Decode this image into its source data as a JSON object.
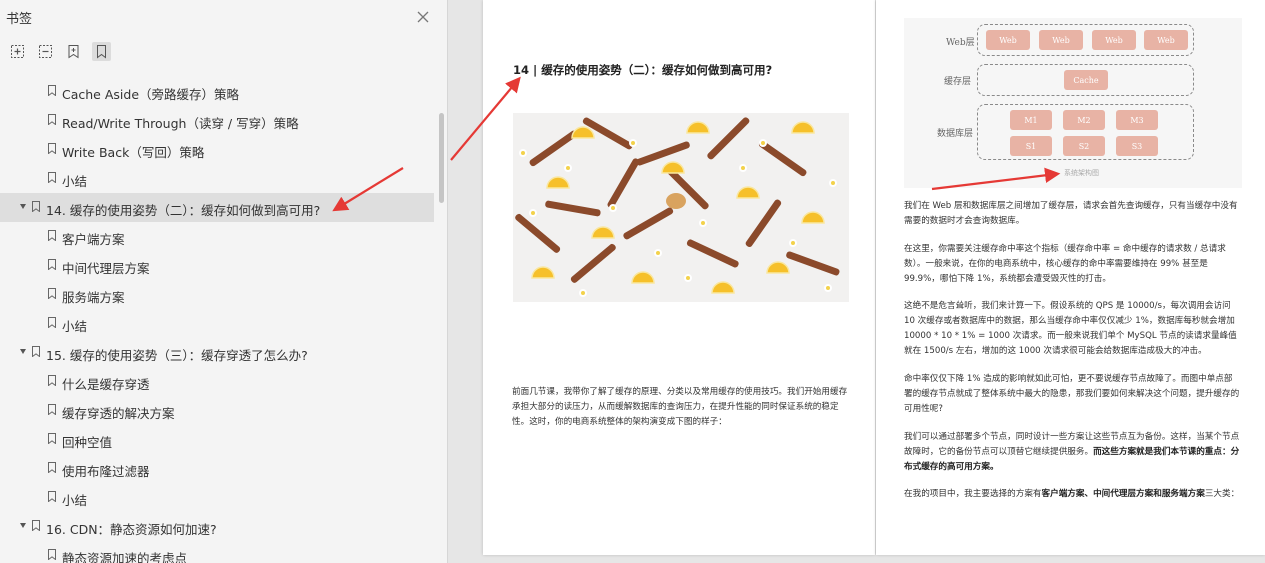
{
  "sidebar": {
    "title": "书签",
    "close_icon": "close-icon",
    "tools": [
      {
        "name": "expand-all-icon"
      },
      {
        "name": "collapse-all-icon"
      },
      {
        "name": "add-bookmark-icon"
      },
      {
        "name": "bookmark-view-icon"
      }
    ],
    "items": [
      {
        "label": "Cache Aside（旁路缓存）策略",
        "level": 2
      },
      {
        "label": "Read/Write Through（读穿 / 写穿）策略",
        "level": 2
      },
      {
        "label": "Write Back（写回）策略",
        "level": 2
      },
      {
        "label": "小结",
        "level": 2
      },
      {
        "label": "14. 缓存的使用姿势（二）：缓存如何做到高可用?",
        "level": 1,
        "selected": true
      },
      {
        "label": "客户端方案",
        "level": 2
      },
      {
        "label": "中间代理层方案",
        "level": 2
      },
      {
        "label": "服务端方案",
        "level": 2
      },
      {
        "label": "小结",
        "level": 2
      },
      {
        "label": "15. 缓存的使用姿势（三）：缓存穿透了怎么办?",
        "level": 1
      },
      {
        "label": "什么是缓存穿透",
        "level": 2
      },
      {
        "label": "缓存穿透的解决方案",
        "level": 2
      },
      {
        "label": "回种空值",
        "level": 2
      },
      {
        "label": "使用布隆过滤器",
        "level": 2
      },
      {
        "label": "小结",
        "level": 2
      },
      {
        "label": "16. CDN：静态资源如何加速?",
        "level": 1
      },
      {
        "label": "静态资源加速的考虑点",
        "level": 2
      }
    ]
  },
  "left_page": {
    "chapter_title": "14 | 缓存的使用姿势（二）：缓存如何做到高可用?",
    "intro": "前面几节课，我带你了解了缓存的原理、分类以及常用缓存的使用技巧。我们开始用缓存承担大部分的读压力，从而缓解数据库的查询压力，在提升性能的同时保证系统的稳定性。这时，你的电商系统整体的架构演变成下图的样子："
  },
  "right_page": {
    "diagram": {
      "web_layer": "Web层",
      "cache_layer": "缓存层",
      "db_layer": "数据库层",
      "web_nodes": [
        "Web",
        "Web",
        "Web",
        "Web"
      ],
      "cache_node": "Cache",
      "db_nodes_top": [
        "M1",
        "M2",
        "M3"
      ],
      "db_nodes_bottom": [
        "S1",
        "S2",
        "S3"
      ],
      "caption": "系统架构图"
    },
    "p1": "我们在 Web 层和数据库层之间增加了缓存层，请求会首先查询缓存，只有当缓存中没有需要的数据时才会查询数据库。",
    "p2": "在这里，你需要关注缓存命中率这个指标（缓存命中率 = 命中缓存的请求数 / 总请求数）。一般来说，在你的电商系统中，核心缓存的命中率需要维持在 99% 甚至是 99.9%，哪怕下降 1%，系统都会遭受毁灭性的打击。",
    "p3": "这绝不是危言耸听，我们来计算一下。假设系统的 QPS 是 10000/s，每次调用会访问 10 次缓存或者数据库中的数据，那么当缓存命中率仅仅减少 1%，数据库每秒就会增加 10000 * 10 * 1% = 1000 次请求。而一般来说我们单个 MySQL 节点的读请求量峰值就在 1500/s 左右，增加的这 1000 次请求很可能会给数据库造成极大的冲击。",
    "p4": "命中率仅仅下降 1% 造成的影响就如此可怕，更不要说缓存节点故障了。而图中单点部署的缓存节点就成了整体系统中最大的隐患，那我们要如何来解决这个问题，提升缓存的可用性呢?",
    "p5_a": "我们可以通过部署多个节点，同时设计一些方案让这些节点互为备份。这样，当某个节点故障时，它的备份节点可以顶替它继续提供服务。",
    "p5_b": "而这些方案就是我们本节课的重点：分布式缓存的高可用方案。",
    "p6_a": "在我的项目中，我主要选择的方案有",
    "p6_b": "客户端方案、中间代理层方案和服务端方案",
    "p6_c": "三大类："
  },
  "colors": {
    "annotation_arrow": "#e53935",
    "diagram_node": "#e8b3a5",
    "selected_row": "#dedede"
  }
}
